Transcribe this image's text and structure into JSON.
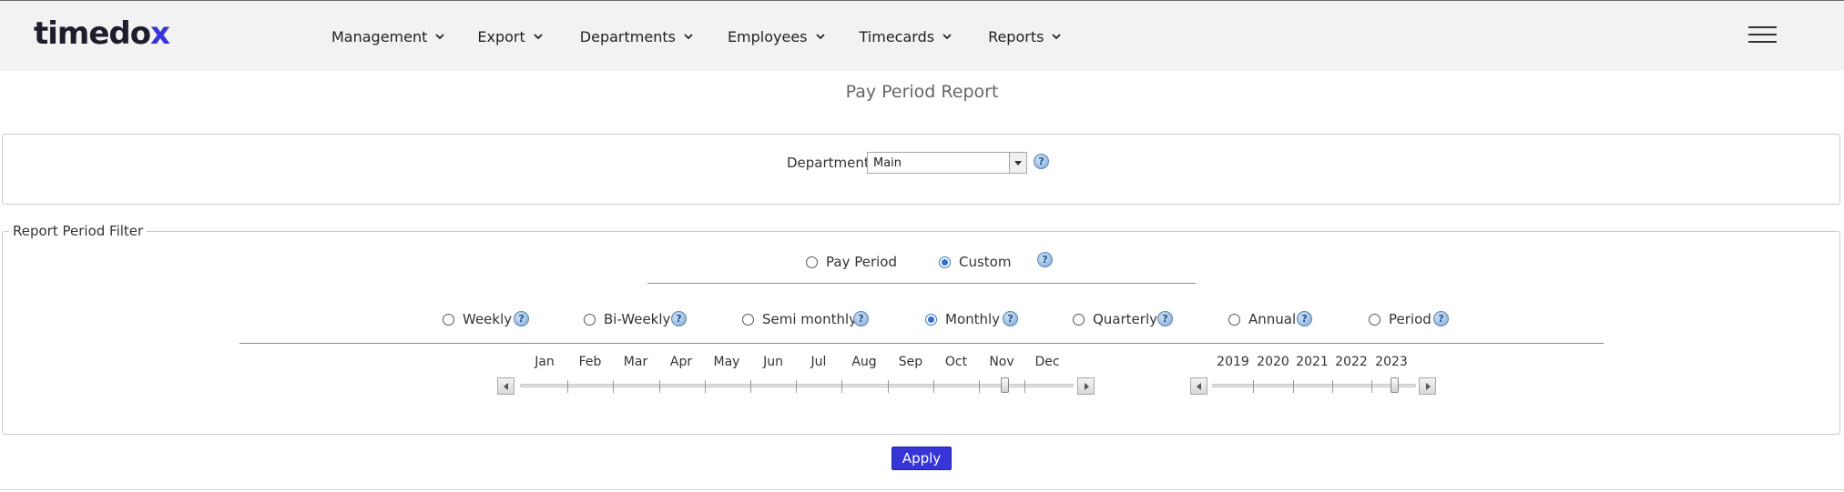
{
  "header": {
    "logo_main": "timedo",
    "logo_accent": "x",
    "nav": [
      {
        "label": "Management"
      },
      {
        "label": "Export"
      },
      {
        "label": "Departments"
      },
      {
        "label": "Employees"
      },
      {
        "label": "Timecards"
      },
      {
        "label": "Reports"
      }
    ],
    "menu_icon": "hamburger-menu-icon"
  },
  "page": {
    "title": "Pay Period Report"
  },
  "department": {
    "label": "Department",
    "selected": "Main",
    "help_icon": "?"
  },
  "report_period": {
    "legend": "Report Period Filter",
    "mode_options": [
      {
        "label": "Pay Period",
        "checked": false
      },
      {
        "label": "Custom",
        "checked": true
      }
    ],
    "mode_help": "?",
    "period_types": [
      {
        "label": "Weekly",
        "checked": false,
        "help": "?"
      },
      {
        "label": "Bi-Weekly",
        "checked": false,
        "help": "?"
      },
      {
        "label": "Semi monthly",
        "checked": false,
        "help": "?"
      },
      {
        "label": "Monthly",
        "checked": true,
        "help": "?"
      },
      {
        "label": "Quarterly",
        "checked": false,
        "help": "?"
      },
      {
        "label": "Annual",
        "checked": false,
        "help": "?"
      },
      {
        "label": "Period",
        "checked": false,
        "help": "?"
      }
    ],
    "month_slider": {
      "labels": [
        "Jan",
        "Feb",
        "Mar",
        "Apr",
        "May",
        "Jun",
        "Jul",
        "Aug",
        "Sep",
        "Oct",
        "Nov",
        "Dec"
      ],
      "selected": "Nov"
    },
    "year_slider": {
      "labels": [
        "2019",
        "2020",
        "2021",
        "2022",
        "2023"
      ],
      "selected": "2023"
    }
  },
  "actions": {
    "apply_label": "Apply"
  },
  "colors": {
    "accent": "#3535d8",
    "logo_x": "#3a34d8",
    "header_bg": "#f2f2f2"
  }
}
